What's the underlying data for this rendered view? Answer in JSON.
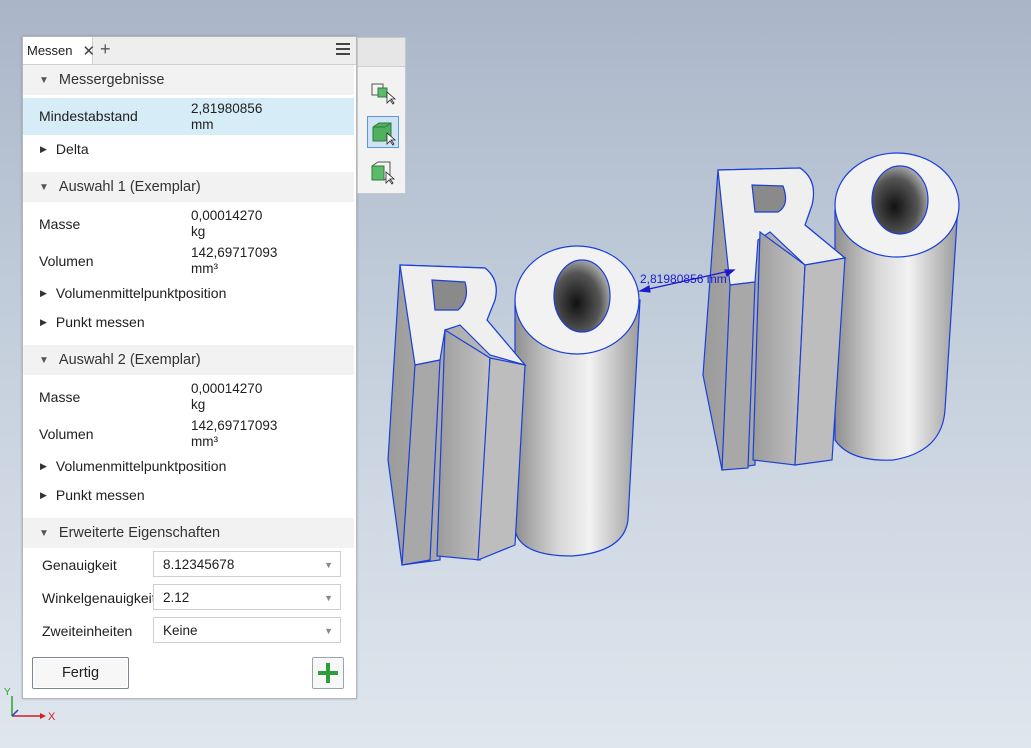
{
  "panel": {
    "tab_label": "Messen",
    "sections": {
      "results": {
        "title": "Messergebnisse",
        "min_distance_label": "Mindestabstand",
        "min_distance_value": "2,81980856",
        "min_distance_unit": "mm",
        "delta_label": "Delta"
      },
      "sel1": {
        "title": "Auswahl 1 (Exemplar)",
        "mass_label": "Masse",
        "mass_value": "0,00014270",
        "mass_unit": "kg",
        "volume_label": "Volumen",
        "volume_value": "142,69717093",
        "volume_unit": "mm³",
        "centroid_label": "Volumenmittelpunktposition",
        "point_label": "Punkt messen"
      },
      "sel2": {
        "title": "Auswahl 2 (Exemplar)",
        "mass_label": "Masse",
        "mass_value": "0,00014270",
        "mass_unit": "kg",
        "volume_label": "Volumen",
        "volume_value": "142,69717093",
        "volume_unit": "mm³",
        "centroid_label": "Volumenmittelpunktposition",
        "point_label": "Punkt messen"
      },
      "advanced": {
        "title": "Erweiterte Eigenschaften",
        "precision_label": "Genauigkeit",
        "precision_value": "8.12345678",
        "angle_precision_label": "Winkelgenauigkeit",
        "angle_precision_value": "2.12",
        "dual_units_label": "Zweiteinheiten",
        "dual_units_value": "Keine"
      }
    },
    "done_button": "Fertig"
  },
  "viewport": {
    "dimension_text": "2,81980856 mm",
    "axis_x": "X",
    "axis_y": "Y",
    "model_text_left": "RO",
    "model_text_right": "RO"
  },
  "colors": {
    "highlight_row": "#d6ecf7",
    "edge_blue": "#1a3fd8",
    "add_green": "#2e9e3a"
  },
  "icons": [
    "close-icon",
    "plus-icon",
    "menu-icon",
    "select-part-icon",
    "select-solid-icon",
    "select-face-icon",
    "add-icon"
  ]
}
